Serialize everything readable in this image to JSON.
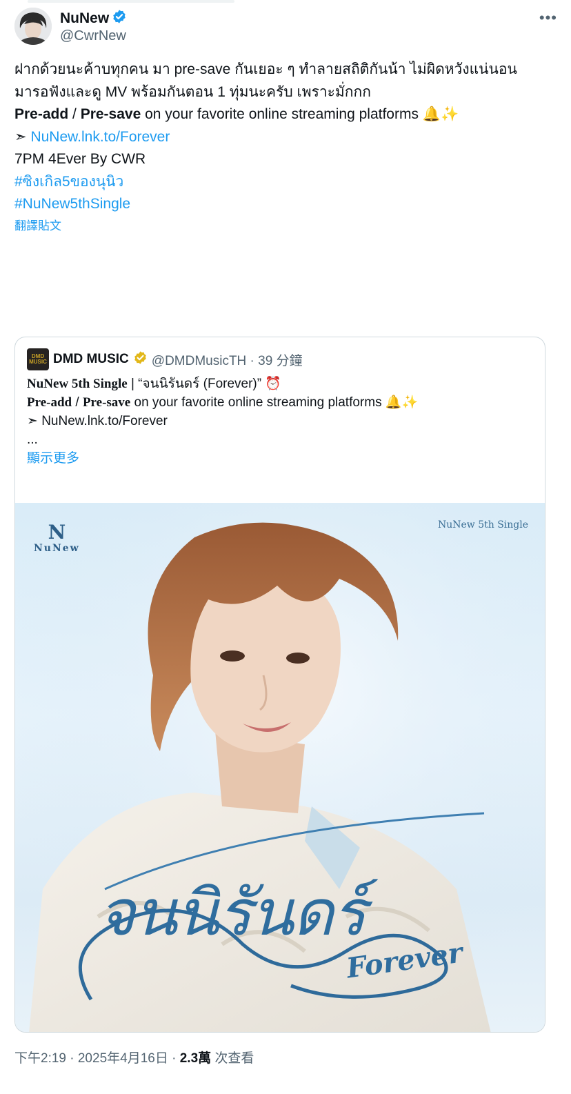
{
  "user": {
    "display_name": "NuNew",
    "handle": "@CwrNew",
    "verified_color": "#1d9bf0"
  },
  "tweet": {
    "line1": "ฝากด้วยนะค้าบทุกคน มา pre-save กันเยอะ ๆ ทำลายสถิติกันน้า ไม่ผิดหวังแน่นอน",
    "line2": "มารอฟังและดู MV พร้อมกันตอน 1 ทุ่มนะครับ เพราะมั่กกก",
    "preadd": "Pre-add",
    "slash": " / ",
    "presave": "Pre-save",
    "platforms": " on your favorite online streaming platforms ",
    "emoji": "🔔✨",
    "arrow": "➣ ",
    "link": "NuNew.lnk.to/Forever",
    "line4": "7PM 4Ever By CWR",
    "hashtag1": "#ซิงเกิล5ของนุนิว",
    "hashtag2": "#NuNew5thSingle",
    "translate": "翻譯貼文"
  },
  "quote": {
    "logo_text": "DMD MUSIC",
    "name": "DMD MUSIC",
    "verified_color": "#e2b719",
    "handle_time": "@DMDMusicTH · 39 分鐘",
    "title_bold": "NuNew 5th Single",
    "title_rest": " | “จนนิรันดร์ (Forever)” ",
    "clock": "⏰",
    "preadd": "Pre-add",
    "slash": " / ",
    "presave": "Pre-save",
    "platforms": " on your favorite online streaming platforms ",
    "emoji": "🔔✨",
    "link_line": "➣ NuNew.lnk.to/Forever",
    "ellipsis": "...",
    "show_more": "顯示更多"
  },
  "media": {
    "brand_mark": "N",
    "brand_word": "NuNew",
    "single_label": "NuNew 5th Single",
    "title_thai": "จนนิรันดร์",
    "title_en": "Forever"
  },
  "footer": {
    "time_date": "下午2:19 · 2025年4月16日 · ",
    "views": "2.3萬",
    "views_label": " 次查看"
  }
}
